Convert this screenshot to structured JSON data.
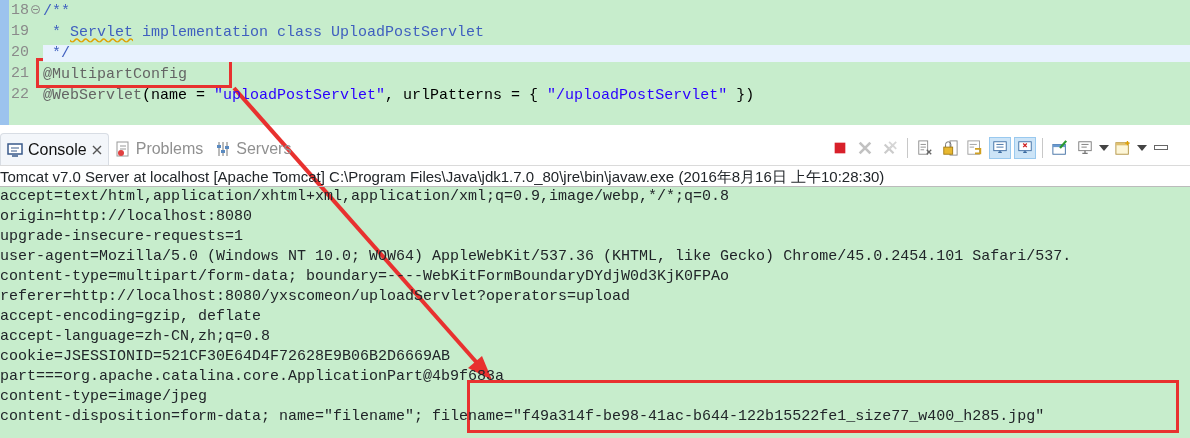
{
  "editor": {
    "lines": [
      {
        "number": "18",
        "folded": false,
        "current": false,
        "segments": [
          {
            "kind": "comment",
            "text": "/**"
          }
        ]
      },
      {
        "number": "19",
        "current": false,
        "segments": [
          {
            "kind": "comment",
            "text": " * "
          },
          {
            "kind": "comment",
            "text": "Servlet",
            "misspelled": true
          },
          {
            "kind": "comment",
            "text": " implementation class UploadPostServlet"
          }
        ]
      },
      {
        "number": "20",
        "current": true,
        "segments": [
          {
            "kind": "comment",
            "text": " */"
          }
        ]
      },
      {
        "number": "21",
        "current": false,
        "segments": [
          {
            "kind": "annotation",
            "text": "@MultipartConfig"
          }
        ]
      },
      {
        "number": "22",
        "current": false,
        "segments": [
          {
            "kind": "annotation",
            "text": "@WebServlet"
          },
          {
            "kind": "plain",
            "text": "(name = "
          },
          {
            "kind": "string",
            "text": "\"uploadPostServlet\""
          },
          {
            "kind": "plain",
            "text": ", urlPatterns = { "
          },
          {
            "kind": "string",
            "text": "\"/uploadPostServlet\""
          },
          {
            "kind": "plain",
            "text": " })"
          }
        ]
      }
    ]
  },
  "tabs": [
    {
      "label": "Console",
      "selected": true
    },
    {
      "label": "Problems",
      "selected": false
    },
    {
      "label": "Servers",
      "selected": false
    }
  ],
  "toolbar": [
    {
      "kind": "stop",
      "disabled": false,
      "selected": false
    },
    {
      "kind": "remove",
      "disabled": true,
      "selected": false
    },
    {
      "kind": "remove-all",
      "disabled": true,
      "selected": false
    },
    {
      "kind": "sep"
    },
    {
      "kind": "clear",
      "disabled": false,
      "selected": false
    },
    {
      "kind": "lock",
      "disabled": false,
      "selected": false
    },
    {
      "kind": "wrap",
      "disabled": false,
      "selected": false
    },
    {
      "kind": "stdout",
      "disabled": false,
      "selected": true
    },
    {
      "kind": "stderr",
      "disabled": false,
      "selected": true
    },
    {
      "kind": "sep"
    },
    {
      "kind": "pin",
      "disabled": false,
      "selected": false
    },
    {
      "kind": "display",
      "disabled": false,
      "selected": false
    },
    {
      "kind": "dropdown"
    },
    {
      "kind": "new",
      "disabled": false,
      "selected": false
    },
    {
      "kind": "dropdown"
    },
    {
      "kind": "minimize",
      "disabled": false,
      "selected": false
    }
  ],
  "console": {
    "title": "Tomcat v7.0 Server at localhost [Apache Tomcat] C:\\Program Files\\Java\\jdk1.7.0_80\\jre\\bin\\javaw.exe (2016年8月16日 上午10:28:30)",
    "lines": [
      "accept=text/html,application/xhtml+xml,application/xml;q=0.9,image/webp,*/*;q=0.8",
      "origin=http://localhost:8080",
      "upgrade-insecure-requests=1",
      "user-agent=Mozilla/5.0 (Windows NT 10.0; WOW64) AppleWebKit/537.36 (KHTML, like Gecko) Chrome/45.0.2454.101 Safari/537.",
      "content-type=multipart/form-data; boundary=----WebKitFormBoundaryDYdjW0d3KjK0FPAo",
      "referer=http://localhost:8080/yxscomeon/uploadServlet?operators=upload",
      "accept-encoding=gzip, deflate",
      "accept-language=zh-CN,zh;q=0.8",
      "cookie=JSESSIONID=521CF30E64D4F72628E9B06B2D6669AB",
      "part===org.apache.catalina.core.ApplicationPart@4b9f683a",
      "content-type=image/jpeg",
      "content-disposition=form-data; name=\"filename\"; filename=\"f49a314f-be98-41ac-b644-122b15522fe1_size77_w400_h285.jpg\""
    ]
  }
}
